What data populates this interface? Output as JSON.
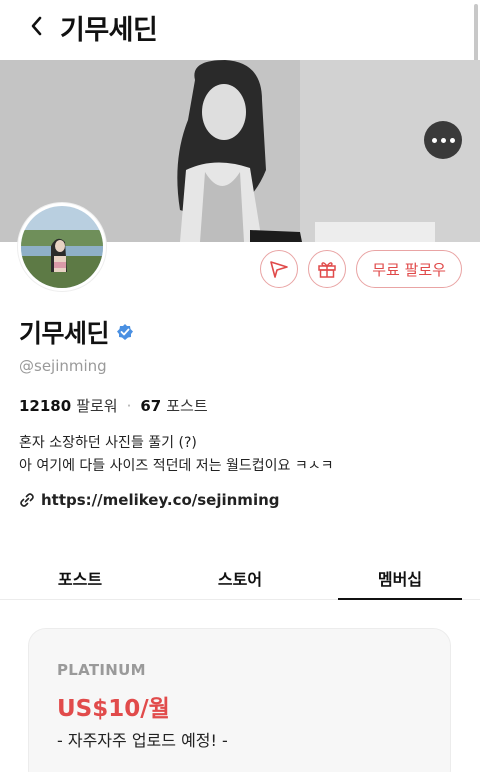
{
  "header": {
    "title": "기무세딘",
    "back_icon": "chevron-left-icon"
  },
  "banner": {
    "more_icon": "more-horizontal-icon"
  },
  "actions": {
    "share_icon": "send-icon",
    "gift_icon": "gift-icon",
    "follow_label": "무료 팔로우"
  },
  "profile": {
    "name": "기무세딘",
    "verified_icon": "verified-badge-icon",
    "handle": "@sejinming",
    "followers_count": "12180",
    "followers_label": "팔로워",
    "dot": "·",
    "posts_count": "67",
    "posts_label": "포스트",
    "bio_line1": "혼자 소장하던 사진들 풀기 (?)",
    "bio_line2": "아 여기에 다들 사이즈 적던데 저는 월드컵이요 ㅋㅅㅋ",
    "link_icon": "link-icon",
    "link": "https://melikey.co/sejinming"
  },
  "tabs": [
    {
      "label": "포스트"
    },
    {
      "label": "스토어"
    },
    {
      "label": "멤버십"
    }
  ],
  "membership": {
    "plan_name": "PLATINUM",
    "price": "US$10/월",
    "description": "- 자주자주 업로드 예정! -"
  },
  "colors": {
    "accent": "#e14b4b",
    "verified": "#4a90e2"
  }
}
